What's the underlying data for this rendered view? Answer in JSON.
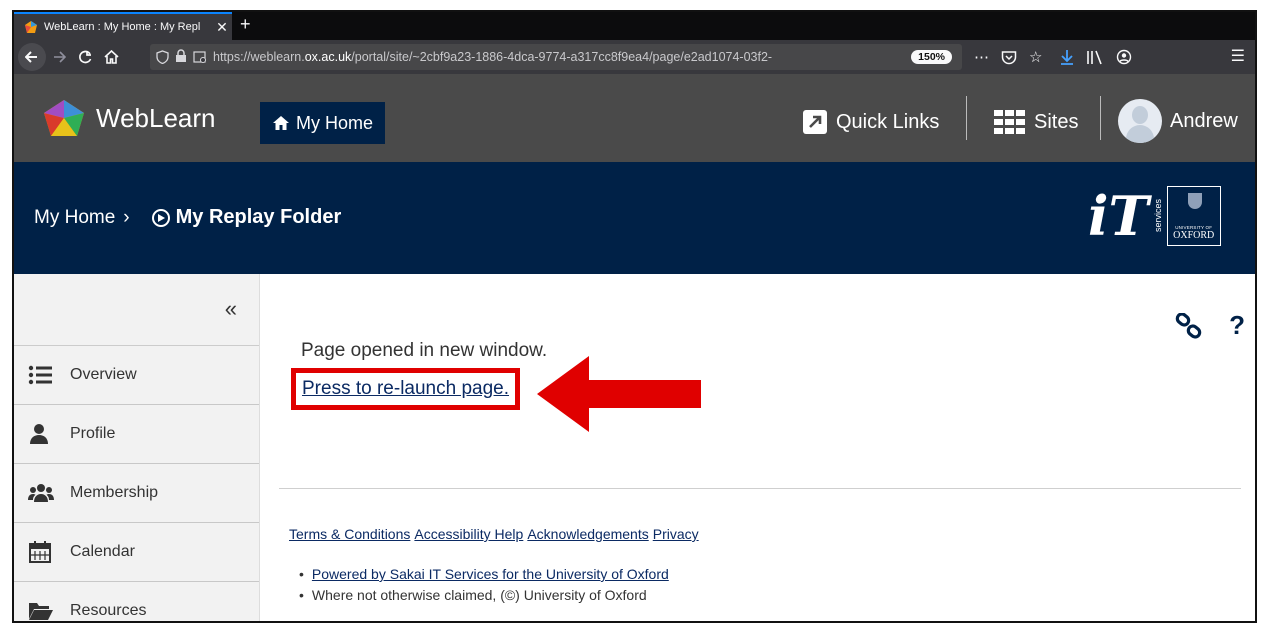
{
  "browser": {
    "tab_title": "WebLearn : My Home : My Repl",
    "tab_close": "✕",
    "new_tab": "+",
    "url_prefix": "https://weblearn.",
    "url_domain": "ox.ac.uk",
    "url_path": "/portal/site/~2cbf9a23-1886-4dca-9774-a317cc8f9ea4/page/e2ad1074-03f2-",
    "zoom": "150%"
  },
  "header": {
    "logo_text": "WebLearn",
    "home_button": "My Home",
    "quick_links": "Quick Links",
    "sites": "Sites",
    "user_name": "Andrew"
  },
  "banner": {
    "breadcrumb_home": "My Home",
    "breadcrumb_sep": "›",
    "current_page": "My Replay Folder",
    "it_services": "services",
    "university_label": "UNIVERSITY OF",
    "oxford": "OXFORD"
  },
  "sidebar": {
    "collapse": "«",
    "items": [
      {
        "label": "Overview",
        "icon": "list-icon"
      },
      {
        "label": "Profile",
        "icon": "user-icon"
      },
      {
        "label": "Membership",
        "icon": "users-icon"
      },
      {
        "label": "Calendar",
        "icon": "calendar-icon"
      },
      {
        "label": "Resources",
        "icon": "folder-icon"
      }
    ]
  },
  "main": {
    "message": "Page opened in new window.",
    "relaunch_link": "Press to re-launch page.",
    "link_icon": "⚭",
    "help_icon": "?"
  },
  "footer": {
    "links": [
      "Terms & Conditions",
      "Accessibility Help",
      "Acknowledgements",
      "Privacy"
    ],
    "powered_by": "Powered by Sakai IT Services for the University of Oxford",
    "copyright": "Where not otherwise claimed, (©) University of Oxford"
  },
  "colors": {
    "annotation_red": "#e00000",
    "oxford_blue": "#002147",
    "header_gray": "#4a4a4a"
  }
}
